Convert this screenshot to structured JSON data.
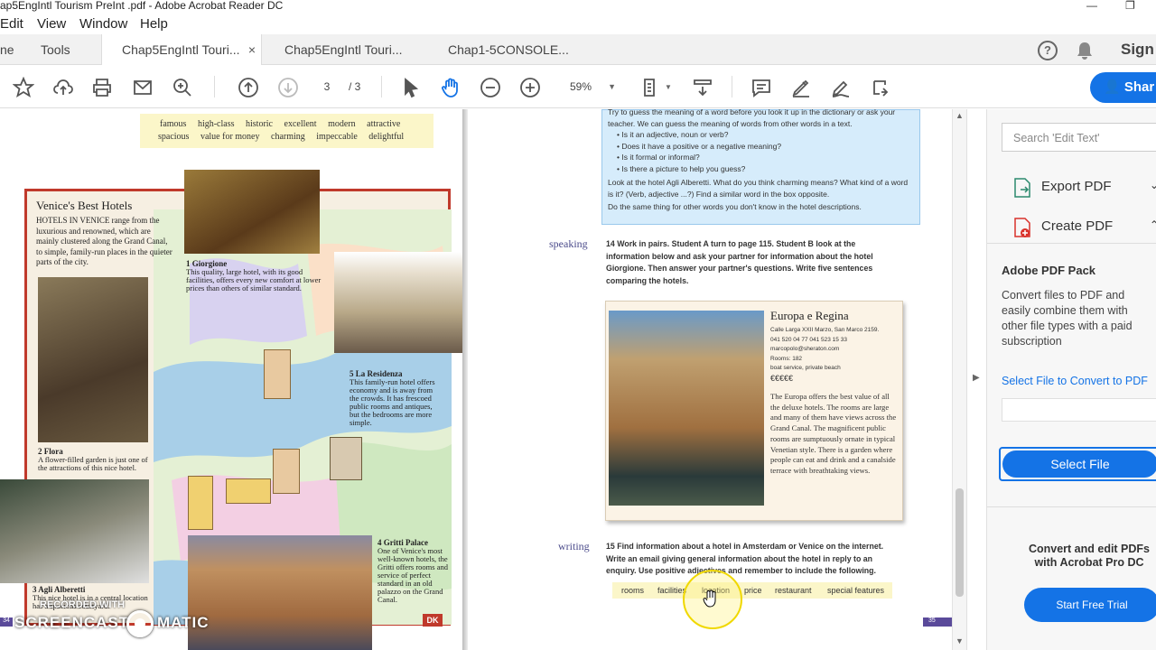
{
  "window": {
    "title": "ap5EngIntl Tourism PreInt .pdf - Adobe Acrobat Reader DC",
    "minimize": "—",
    "restore": "❐"
  },
  "menu": {
    "edit": "Edit",
    "view": "View",
    "window": "Window",
    "help": "Help"
  },
  "tabs": {
    "home": "ne",
    "tools": "Tools",
    "tab1": "Chap5EngIntl Touri...",
    "tab1_close": "×",
    "tab2": "Chap5EngIntl Touri...",
    "tab3": "Chap1-5CONSOLE..."
  },
  "header_right": {
    "help": "?",
    "sign": "Sign",
    "share": "Shar"
  },
  "toolbar": {
    "page_current": "3",
    "page_total": "/ 3",
    "zoom": "59%"
  },
  "left_page": {
    "vocab_row1": [
      "famous",
      "high-class",
      "historic",
      "excellent",
      "modern",
      "attractive"
    ],
    "vocab_row2": [
      "spacious",
      "value for money",
      "charming",
      "impeccable",
      "delightful"
    ],
    "box_title": "Venice's Best Hotels",
    "box_text": "HOTELS IN VENICE range from the luxurious and renowned, which are mainly clustered along the Grand Canal, to simple, family-run places in the quieter parts of the city.",
    "h1_title": "1 Giorgione",
    "h1_text": "This quality, large hotel, with its good facilities, offers every new comfort at lower prices than others of similar standard.",
    "h2_title": "2 Flora",
    "h2_text": "A flower-filled garden is just one of the attractions of this nice hotel.",
    "h3_title": "3 Agli Alberetti",
    "h3_text": "This nice hotel is in a central location has a spacious courtyard.",
    "h4_title": "4 Gritti Palace",
    "h4_text": "One of Venice's most well-known hotels, the Gritti offers rooms and service of perfect standard in an old palazzo on the Grand Canal.",
    "h5_title": "5 La Residenza",
    "h5_text": "This family-run hotel offers economy and is away from the crowds. It has frescoed public rooms and antiques, but the bedrooms are more simple.",
    "page_num": "34",
    "dk": "DK"
  },
  "right_page": {
    "intro_text": "Try to guess the meaning of a word before you look it up in the dictionary or ask your teacher. We can guess the meaning of words from other words in a text.",
    "bullets": [
      "Is it an adjective, noun or verb?",
      "Does it have a positive or a negative meaning?",
      "Is it formal or informal?",
      "Is there a picture to help you guess?"
    ],
    "look_text": "Look at the hotel Agli Alberetti. What do you think charming means? What kind of a word is it? (Verb, adjective ...?) Find a similar word in the box opposite.",
    "same_text": "Do the same thing for other words you don't know in the hotel descriptions.",
    "speaking_label": "speaking",
    "speaking_text": "14  Work in pairs. Student A turn to page 115. Student B look at the information below and ask your partner for information about the hotel Giorgione. Then answer your partner's questions. Write five sentences comparing the hotels.",
    "europa_title": "Europa e Regina",
    "europa_address": "Calle Larga XXII Marzo, San Marco 2159.",
    "europa_phone": "041 520 04 77  041 523 15 33",
    "europa_email": "marcopolo@sheraton.com",
    "europa_rooms": "Rooms: 182",
    "europa_boat": "boat service, private beach",
    "europa_stars": "€€€€€",
    "europa_desc": "The Europa offers the best value of all the deluxe hotels. The rooms are large and many of them have views across the Grand Canal. The magnificent public rooms are sumptuously ornate in typical Venetian style. There is a garden where people can eat and drink and a canalside terrace with breathtaking views.",
    "writing_label": "writing",
    "writing_text": "15  Find information about a hotel in Amsterdam or Venice on the internet. Write an email giving general information about the hotel in reply to an enquiry. Use positive adjectives and remember to include the following.",
    "writing_words": [
      "rooms",
      "facilities",
      "location",
      "price",
      "restaurant",
      "special features"
    ],
    "page_num": "35"
  },
  "panel": {
    "search_placeholder": "Search 'Edit Text'",
    "export": "Export PDF",
    "create": "Create PDF",
    "pack_title": "Adobe PDF Pack",
    "pack_desc": "Convert files to PDF and easily combine them with other file types with a paid subscription",
    "select_link": "Select File to Convert to PDF",
    "select_btn": "Select File",
    "promo": "Convert and edit PDFs with Acrobat Pro DC",
    "trial_btn": "Start Free Trial"
  },
  "watermark": {
    "line1": "RECORDED WITH",
    "line2": "SCREENCAST",
    "line3": "MATIC"
  },
  "colors": {
    "accent": "#1473e6",
    "info_box": "#d6ecfb",
    "vocab_bg": "#fbf6c9",
    "box_border": "#c0392b"
  }
}
